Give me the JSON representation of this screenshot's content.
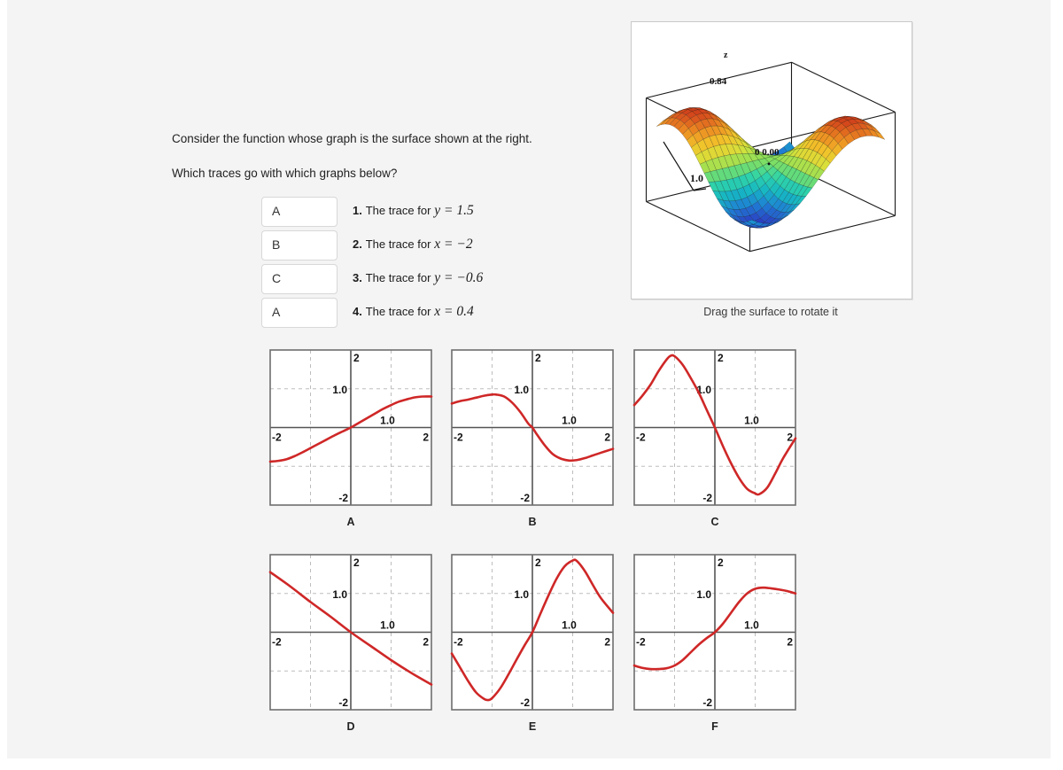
{
  "prompt": {
    "line1": "Consider the function whose graph is the surface shown at the right.",
    "line2": "Which traces go with which graphs below?"
  },
  "matching": {
    "rows": [
      {
        "answer": "A",
        "number": "1.",
        "label": "The trace for",
        "equation": "y = 1.5",
        "var": "y",
        "value": "1.5"
      },
      {
        "answer": "B",
        "number": "2.",
        "label": "The trace for",
        "equation": "x = −2",
        "var": "x",
        "value": "−2"
      },
      {
        "answer": "C",
        "number": "3.",
        "label": "The trace for",
        "equation": "y = −0.6",
        "var": "y",
        "value": "−0.6"
      },
      {
        "answer": "A",
        "number": "4.",
        "label": "The trace for",
        "equation": "x = 0.4",
        "var": "x",
        "value": "0.4"
      }
    ],
    "options": [
      "A",
      "B",
      "C",
      "D",
      "E",
      "F"
    ]
  },
  "surface": {
    "caption": "Drag the surface to rotate it",
    "axis_label_z": "z",
    "tick_upper_left": "0.84",
    "tick_center": "0 0.00",
    "tick_lower_left": "1.0",
    "colormap": [
      "#241d8f",
      "#2b3fc4",
      "#1f7fd4",
      "#16b6c4",
      "#2fd4a8",
      "#8ae05a",
      "#d8e03a",
      "#f2c22a",
      "#ec8a22",
      "#d4451c",
      "#8c1410"
    ],
    "description": "saddle / butterfly surface with two peaks and two valleys"
  },
  "colors": {
    "curve": "#cf2727",
    "frame": "#6e6e6e",
    "grid": "#bdbdbd",
    "axis": "#555555",
    "page_bg": "#f4f4f4"
  },
  "chart_data": [
    {
      "id": "A",
      "type": "line",
      "title": "A",
      "xlabel": "",
      "ylabel": "",
      "xlim": [
        -2,
        2
      ],
      "ylim": [
        -2,
        2
      ],
      "xticks": [
        "-2",
        "1.0",
        "2"
      ],
      "yticks": [
        "2",
        "1.0",
        "-2"
      ],
      "grid": true,
      "x": [
        -2.0,
        -1.8,
        -1.6,
        -1.4,
        -1.2,
        -1.0,
        -0.8,
        -0.6,
        -0.4,
        -0.2,
        0.0,
        0.2,
        0.4,
        0.6,
        0.8,
        1.0,
        1.2,
        1.4,
        1.6,
        1.8,
        2.0
      ],
      "y": [
        -0.88,
        -0.86,
        -0.82,
        -0.74,
        -0.64,
        -0.53,
        -0.42,
        -0.31,
        -0.2,
        -0.1,
        0.0,
        0.12,
        0.24,
        0.36,
        0.48,
        0.58,
        0.67,
        0.73,
        0.78,
        0.8,
        0.8
      ]
    },
    {
      "id": "B",
      "type": "line",
      "title": "B",
      "xlabel": "",
      "ylabel": "",
      "xlim": [
        -2,
        2
      ],
      "ylim": [
        -2,
        2
      ],
      "xticks": [
        "-2",
        "1.0",
        "2"
      ],
      "yticks": [
        "2",
        "1.0",
        "-2"
      ],
      "grid": true,
      "x": [
        -2.0,
        -1.8,
        -1.6,
        -1.4,
        -1.2,
        -1.0,
        -0.9,
        -0.7,
        -0.5,
        -0.3,
        -0.1,
        0.0,
        0.1,
        0.3,
        0.5,
        0.7,
        0.9,
        1.1,
        1.3,
        1.5,
        1.7,
        2.0
      ],
      "y": [
        0.62,
        0.68,
        0.72,
        0.77,
        0.82,
        0.85,
        0.85,
        0.8,
        0.64,
        0.4,
        0.1,
        0.0,
        -0.16,
        -0.45,
        -0.68,
        -0.8,
        -0.85,
        -0.84,
        -0.79,
        -0.72,
        -0.65,
        -0.55
      ]
    },
    {
      "id": "C",
      "type": "line",
      "title": "C",
      "xlabel": "",
      "ylabel": "",
      "xlim": [
        -2,
        2
      ],
      "ylim": [
        -2,
        2
      ],
      "xticks": [
        "-2",
        "1.0",
        "2"
      ],
      "yticks": [
        "2",
        "1.0",
        "-2"
      ],
      "grid": true,
      "x": [
        -2.0,
        -1.8,
        -1.6,
        -1.4,
        -1.2,
        -1.1,
        -1.0,
        -0.8,
        -0.6,
        -0.4,
        -0.2,
        0.0,
        0.2,
        0.4,
        0.6,
        0.8,
        1.0,
        1.1,
        1.3,
        1.5,
        1.7,
        2.0
      ],
      "y": [
        0.58,
        0.82,
        1.1,
        1.45,
        1.75,
        1.85,
        1.84,
        1.62,
        1.28,
        0.9,
        0.45,
        0.0,
        -0.48,
        -0.92,
        -1.3,
        -1.58,
        -1.7,
        -1.72,
        -1.55,
        -1.18,
        -0.78,
        -0.28
      ]
    },
    {
      "id": "D",
      "type": "line",
      "title": "D",
      "xlabel": "",
      "ylabel": "",
      "xlim": [
        -2,
        2
      ],
      "ylim": [
        -2,
        2
      ],
      "xticks": [
        "-2",
        "1.0",
        "2"
      ],
      "yticks": [
        "2",
        "1.0",
        "-2"
      ],
      "grid": true,
      "x": [
        -2.0,
        -1.5,
        -1.0,
        -0.5,
        0.0,
        0.5,
        1.0,
        1.5,
        2.0
      ],
      "y": [
        1.55,
        1.18,
        0.78,
        0.4,
        0.0,
        -0.36,
        -0.72,
        -1.05,
        -1.35
      ]
    },
    {
      "id": "E",
      "type": "line",
      "title": "E",
      "xlabel": "",
      "ylabel": "",
      "xlim": [
        -2,
        2
      ],
      "ylim": [
        -2,
        2
      ],
      "xticks": [
        "-2",
        "1.0",
        "2"
      ],
      "yticks": [
        "2",
        "1.0",
        "-2"
      ],
      "grid": true,
      "x": [
        -2.0,
        -1.8,
        -1.6,
        -1.4,
        -1.2,
        -1.1,
        -1.0,
        -0.8,
        -0.6,
        -0.4,
        -0.2,
        0.0,
        0.2,
        0.4,
        0.6,
        0.8,
        1.0,
        1.1,
        1.3,
        1.5,
        1.7,
        2.0
      ],
      "y": [
        -0.55,
        -0.9,
        -1.25,
        -1.55,
        -1.72,
        -1.75,
        -1.7,
        -1.45,
        -1.1,
        -0.72,
        -0.35,
        0.0,
        0.48,
        0.95,
        1.38,
        1.7,
        1.85,
        1.84,
        1.58,
        1.22,
        0.88,
        0.5
      ]
    },
    {
      "id": "F",
      "type": "line",
      "title": "F",
      "xlabel": "",
      "ylabel": "",
      "xlim": [
        -2,
        2
      ],
      "ylim": [
        -2,
        2
      ],
      "xticks": [
        "-2",
        "1.0",
        "2"
      ],
      "yticks": [
        "2",
        "1.0",
        "-2"
      ],
      "grid": true,
      "x": [
        -2.0,
        -1.8,
        -1.6,
        -1.4,
        -1.2,
        -1.0,
        -0.8,
        -0.6,
        -0.4,
        -0.2,
        0.0,
        0.2,
        0.4,
        0.6,
        0.8,
        1.0,
        1.2,
        1.4,
        1.6,
        1.8,
        2.0
      ],
      "y": [
        -0.86,
        -0.92,
        -0.95,
        -0.95,
        -0.93,
        -0.86,
        -0.72,
        -0.52,
        -0.32,
        -0.15,
        0.0,
        0.22,
        0.5,
        0.78,
        1.0,
        1.12,
        1.15,
        1.13,
        1.1,
        1.06,
        1.0
      ]
    }
  ]
}
